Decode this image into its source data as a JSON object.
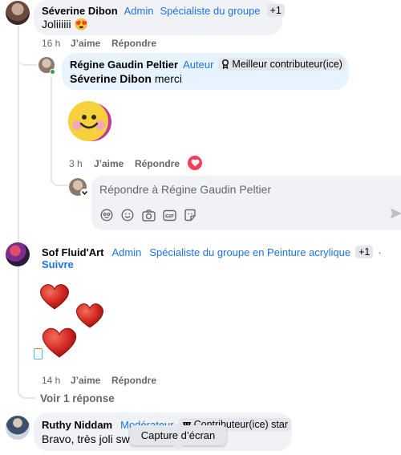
{
  "comment1": {
    "author": "Séverine Dibon",
    "role": "Admin",
    "badge": "Spécialiste du groupe",
    "extra_badges": "+1",
    "text": "Joliiiiii 😍",
    "time": "16 h",
    "like": "J’aime",
    "reply": "Répondre"
  },
  "reply1": {
    "author": "Régine Gaudin Peltier",
    "role": "Auteur",
    "badge": "Meilleur contributeur(ice)",
    "mention": "Séverine Dibon",
    "text": "merci",
    "time": "3 h",
    "like": "J’aime",
    "reply": "Répondre"
  },
  "composer": {
    "placeholder": "Répondre à Régine Gaudin Peltier",
    "icons": [
      "avatar-sticker-icon",
      "emoji-icon",
      "camera-icon",
      "gif-icon",
      "sticker-icon"
    ]
  },
  "comment2": {
    "author": "Sof Fluid'Art",
    "role": "Admin",
    "badge": "Spécialiste du groupe en Peinture acrylique",
    "extra_badges": "+1",
    "separator": "·",
    "follow": "Suivre",
    "time": "14 h",
    "like": "J’aime",
    "reply": "Répondre",
    "view_replies": "Voir 1 réponse"
  },
  "comment3": {
    "author": "Ruthy Niddam",
    "role": "Modérateur",
    "badge": "Contributeur(ice) star",
    "text": "Bravo, très joli swi"
  },
  "tooltip": "Capture d’écran",
  "colors": {
    "accent": "#1b74e4",
    "bubble": "#f0f2f5",
    "bubble_highlight": "#e7f3ff",
    "meta": "#65676b",
    "reaction_heart": "#f33e58"
  }
}
